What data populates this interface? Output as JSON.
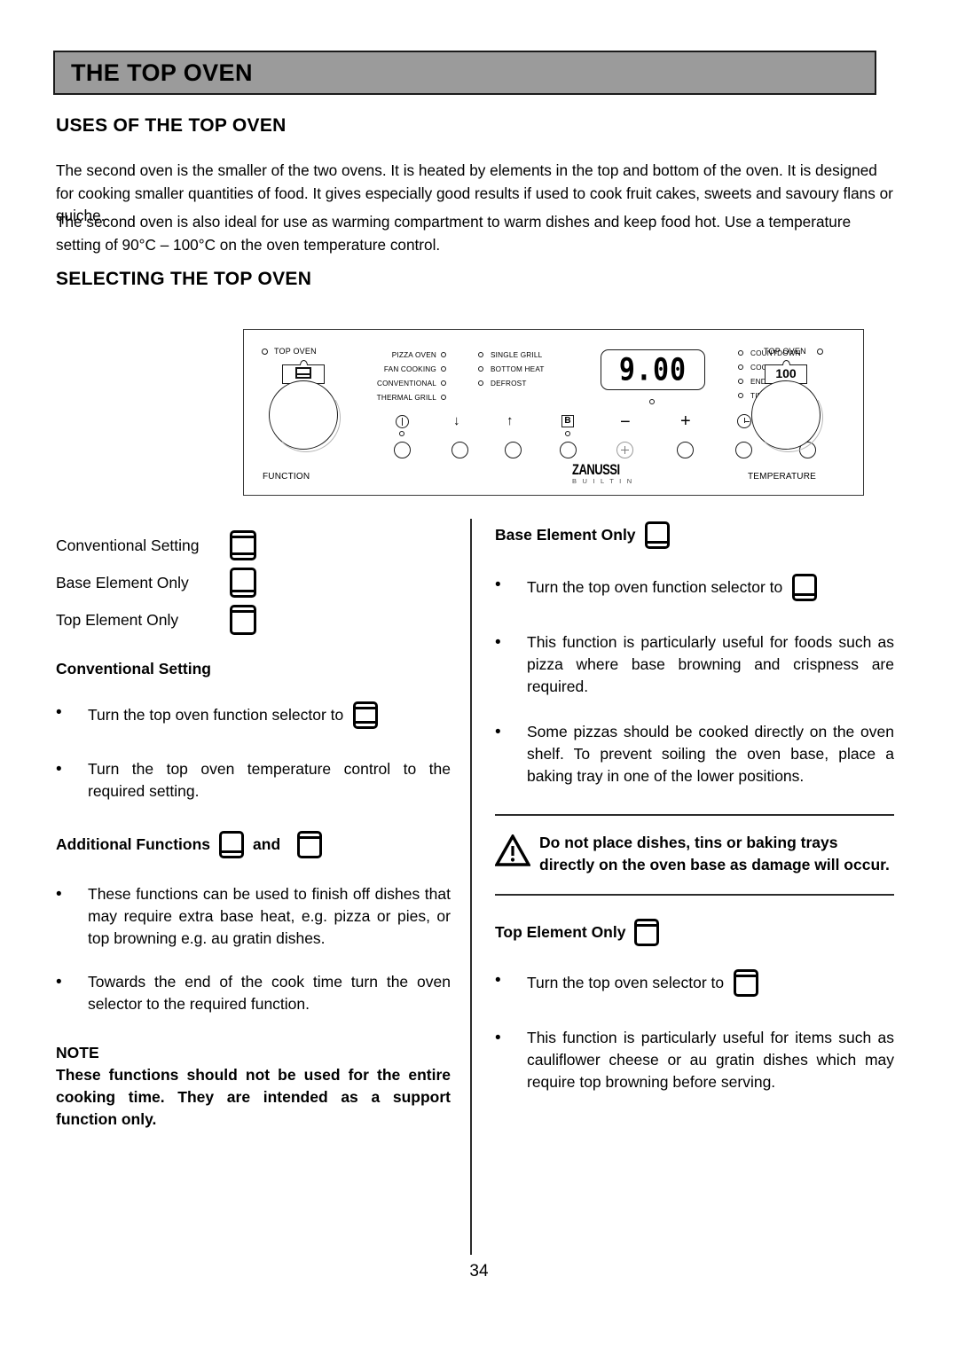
{
  "document": {
    "title": "THE TOP OVEN",
    "page_number": "34"
  },
  "sections": {
    "uses": {
      "heading": "USES OF THE TOP OVEN",
      "paragraph_1": "The second oven is the smaller of the two ovens.  It is heated by elements in the top and bottom of the oven.  It is designed for cooking smaller quantities of food.  It gives especially good results if used to cook fruit cakes, sweets and savoury flans or quiche.",
      "paragraph_2": "The second oven is also ideal for use as warming compartment to warm dishes and keep food hot.  Use a temperature setting of 90°C – 100°C on the oven temperature control."
    },
    "selecting": {
      "heading": "SELECTING THE TOP OVEN"
    }
  },
  "control_panel": {
    "function_knob": {
      "top_label": "TOP OVEN",
      "caption": "FUNCTION",
      "indicator_icon": "conventional-oven-icon"
    },
    "temperature_knob": {
      "top_label": "TOP OVEN",
      "caption": "TEMPERATURE",
      "setting_value": "100"
    },
    "function_list_left": [
      "PIZZA  OVEN",
      "FAN COOKING",
      "CONVENTIONAL",
      "THERMAL  GRILL"
    ],
    "function_list_right": [
      "SINGLE GRILL",
      "BOTTOM HEAT",
      "DEFROST"
    ],
    "timer_modes": [
      "COUNTDOWN",
      "COOKTIME",
      "ENDTIME",
      "TIME"
    ],
    "display_value": "9.00",
    "buttons": [
      {
        "icon": "power-icon",
        "name": "power-button"
      },
      {
        "icon": "arrow-down-icon",
        "name": "decrease-button"
      },
      {
        "icon": "arrow-up-icon",
        "name": "increase-button"
      },
      {
        "icon": "b-box-icon",
        "name": "b-function-button"
      },
      {
        "icon": "minus-icon",
        "name": "minus-button"
      },
      {
        "icon": "plus-icon",
        "name": "plus-button"
      },
      {
        "icon": "clock-icon",
        "name": "timer-button"
      },
      {
        "icon": "lamp-icon",
        "name": "oven-light-button"
      }
    ],
    "minus_symbol": "−",
    "plus_symbol": "+",
    "brand": {
      "name": "ZANUSSI",
      "tagline": "B U I L T   I N"
    }
  },
  "left_column": {
    "legend": [
      {
        "label": "Conventional Setting",
        "icon": "oven-conventional-icon"
      },
      {
        "label": "Base Element Only",
        "icon": "oven-base-element-icon"
      },
      {
        "label": "Top Element Only",
        "icon": "oven-top-element-icon"
      }
    ],
    "conventional": {
      "heading": "Conventional Setting",
      "bullet_1_text": "Turn the top oven function selector to",
      "bullet_1_icon": "oven-conventional-icon",
      "bullet_2": "Turn the top oven temperature control to the required setting."
    },
    "additional": {
      "heading": "Additional Functions",
      "and_word": "and",
      "icon_1": "oven-base-element-icon",
      "icon_2": "oven-top-element-icon",
      "bullet_1": "These functions can be used to finish off dishes that may require extra base heat, e.g. pizza or pies, or top browning e.g. au gratin dishes.",
      "bullet_2": "Towards the end of the cook time turn the oven selector to the required function."
    },
    "note": {
      "heading": "NOTE",
      "body": "These functions should not be used for the entire cooking time.  They are intended as a support function only."
    }
  },
  "right_column": {
    "base_element": {
      "heading": "Base Element Only",
      "heading_icon": "oven-base-element-icon",
      "bullet_1_text": "Turn the top oven function selector to",
      "bullet_1_icon": "oven-base-element-icon",
      "bullet_2": "This function is particularly useful for foods such as pizza where base browning and crispness are required.",
      "bullet_3": "Some pizzas should be cooked directly on the oven shelf.  To prevent soiling the oven base, place a baking tray in one of the lower positions."
    },
    "warning": {
      "icon": "warning-triangle-icon",
      "text": "Do not place dishes, tins or baking trays directly on the oven base as damage will occur."
    },
    "top_element": {
      "heading": "Top Element Only",
      "heading_icon": "oven-top-element-icon",
      "bullet_1_text": "Turn the top oven selector to",
      "bullet_1_icon": "oven-top-element-icon",
      "bullet_2": "This function is particularly useful for items such as cauliflower cheese or au gratin dishes which may require top browning before serving."
    }
  },
  "colors": {
    "title_bar_fill": "#9b9b9b",
    "ink": "#000000",
    "rule": "#2c2c2c"
  }
}
